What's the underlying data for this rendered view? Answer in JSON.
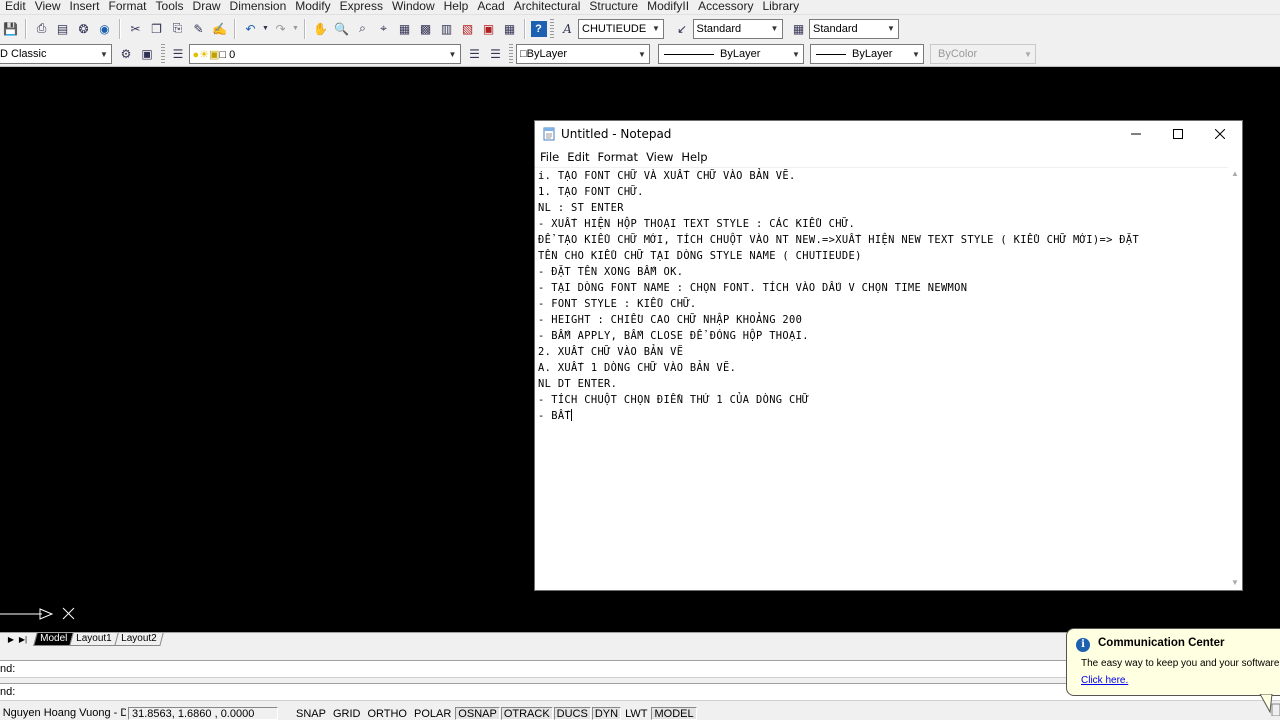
{
  "menubar": {
    "items": [
      "Edit",
      "View",
      "Insert",
      "Format",
      "Tools",
      "Draw",
      "Dimension",
      "Modify",
      "Express",
      "Window",
      "Help",
      "Acad",
      "Architectural",
      "Structure",
      "ModifyII",
      "Accessory",
      "Library"
    ]
  },
  "toolbar1": {
    "text_style": "CHUTIEUDE",
    "dim_style": "Standard",
    "table_style": "Standard"
  },
  "toolbar2": {
    "workspace": "D Classic",
    "layer": "0",
    "color": "ByLayer",
    "linetype": "ByLayer",
    "lineweight": "ByLayer",
    "plotstyle": "ByColor"
  },
  "layout_tabs": [
    "Model",
    "Layout1",
    "Layout2"
  ],
  "command": {
    "line1": "nd:",
    "line2": "nd:"
  },
  "status": {
    "user": "- Nguyen Hoang Vuong - DN",
    "coords": "31.8563,  1.6860 , 0.0000",
    "buttons": [
      "SNAP",
      "GRID",
      "ORTHO",
      "POLAR",
      "OSNAP",
      "OTRACK",
      "DUCS",
      "DYN",
      "LWT",
      "MODEL"
    ]
  },
  "notepad": {
    "title": "Untitled - Notepad",
    "menu": [
      "File",
      "Edit",
      "Format",
      "View",
      "Help"
    ],
    "lines": [
      "i. TẠO FONT CHỮ VÀ XUẤT CHỮ VÀO BẢN VẼ.",
      "1. TẠO FONT CHỮ.",
      "NL : ST ENTER",
      "- XUẤT HIỆN HỘP THOẠI TEXT STYLE : CÁC KIỂU CHỮ.",
      "ĐỂ TẠO KIỂU CHỮ MỚI, TÍCH CHUỘT VÀO NT NEW.=>XUẤT HIỆN NEW TEXT STYLE ( KIỂU CHỮ MỚI)=> ĐẶT",
      "TÊN CHO KIỂU CHỮ TẠI DÒNG STYLE NAME ( CHUTIEUDE)",
      "- ĐẶT TÊN XONG BẤM OK.",
      "- TẠI DÒNG FONT NAME : CHỌN FONT. TÍCH VÀO DẤU V CHỌN TIME NEWMON",
      "- FONT STYLE : KIỂU CHỮ.",
      "- HEIGHT : CHIỀU CAO CHỮ NHẬP KHOẢNG 200",
      "- BẤM APPLY, BẤM CLOSE ĐỂ ĐÓNG HỘP THOẠI.",
      "2. XUẤT CHỮ VÀO BẢN VẼ",
      "A. XUẤT 1 DÒNG CHỮ VÀO BẢN VẼ.",
      "NL DT ENTER.",
      "- TÍCH CHUỘT CHỌN ĐIỂN THỨ 1 CỦA DÒNG CHỮ",
      "- BẤT"
    ]
  },
  "comm_center": {
    "title": "Communication Center",
    "message": "The easy way to keep you and your software u",
    "link": "Click here."
  }
}
